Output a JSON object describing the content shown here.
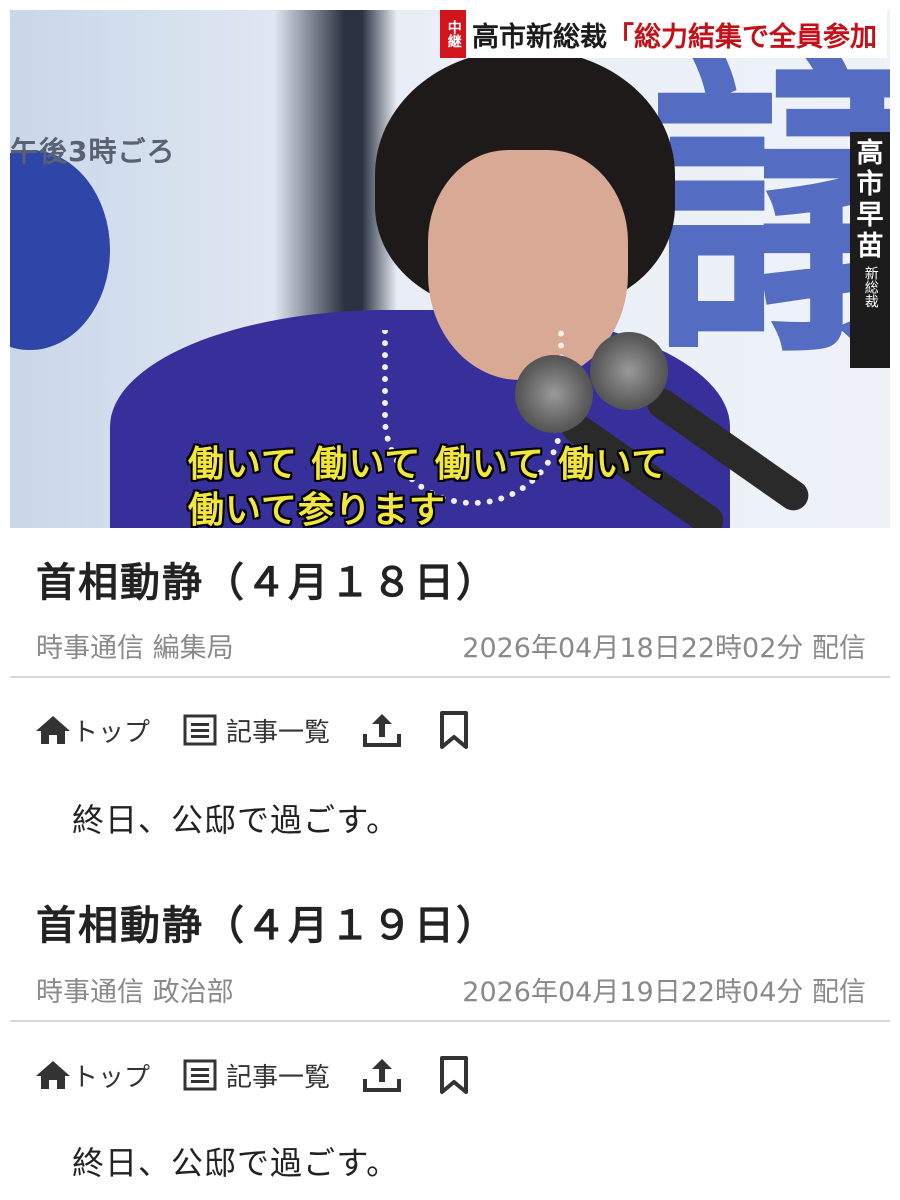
{
  "video": {
    "live_badge": "中継",
    "headline_name": "高市新総裁",
    "headline_quote": "「総力結集で全員参加",
    "time_caption": "午後3時ごろ",
    "name_plate": [
      "高",
      "市",
      "早",
      "苗"
    ],
    "name_plate_title": "新総裁",
    "subtitle_lines": [
      "働いて 働いて 働いて 働いて",
      "働いて参ります"
    ]
  },
  "articles": [
    {
      "title": "首相動静（４月１８日）",
      "source": "時事通信 編集局",
      "date": "2026年04月18日22時02分 配信",
      "toolbar": {
        "top_label": "トップ",
        "list_label": "記事一覧"
      },
      "body": "終日、公邸で過ごす。"
    },
    {
      "title": "首相動静（４月１９日）",
      "source": "時事通信 政治部",
      "date": "2026年04月19日22時04分 配信",
      "toolbar": {
        "top_label": "トップ",
        "list_label": "記事一覧"
      },
      "body": "終日、公邸で過ごす。"
    }
  ],
  "icons": [
    "home-icon",
    "article-list-icon",
    "share-icon",
    "bookmark-icon"
  ],
  "colors": {
    "live_red": "#d2141c",
    "subtitle_yellow": "#f3e63b",
    "meta_gray": "#8a8a8a"
  }
}
